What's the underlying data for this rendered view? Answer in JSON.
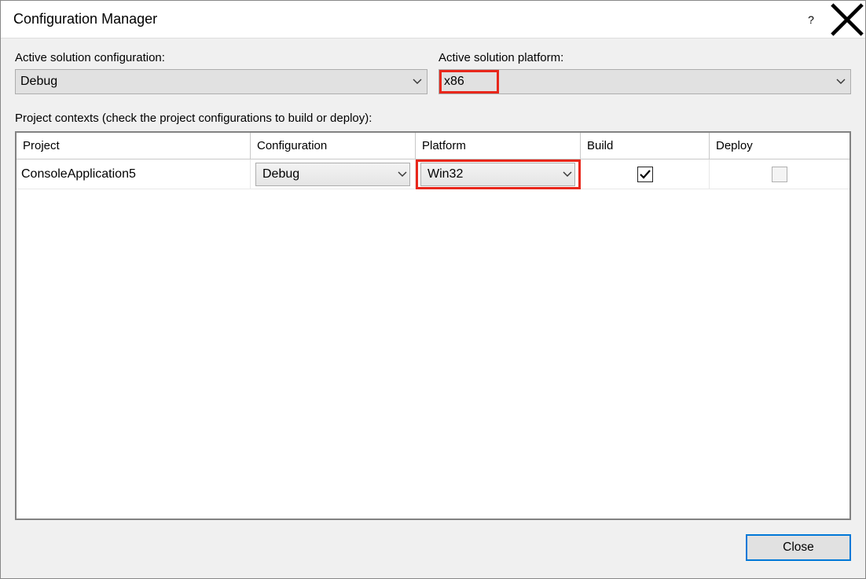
{
  "window": {
    "title": "Configuration Manager",
    "help_symbol": "?",
    "close_symbol": "✕"
  },
  "labels": {
    "active_config": "Active solution configuration:",
    "active_platform": "Active solution platform:",
    "project_contexts": "Project contexts (check the project configurations to build or deploy):",
    "close_button": "Close"
  },
  "solution": {
    "config_value": "Debug",
    "platform_value": "x86"
  },
  "columns": {
    "project": "Project",
    "configuration": "Configuration",
    "platform": "Platform",
    "build": "Build",
    "deploy": "Deploy"
  },
  "rows": [
    {
      "project": "ConsoleApplication5",
      "configuration": "Debug",
      "platform": "Win32",
      "build_checked": true,
      "deploy_enabled": false
    }
  ]
}
